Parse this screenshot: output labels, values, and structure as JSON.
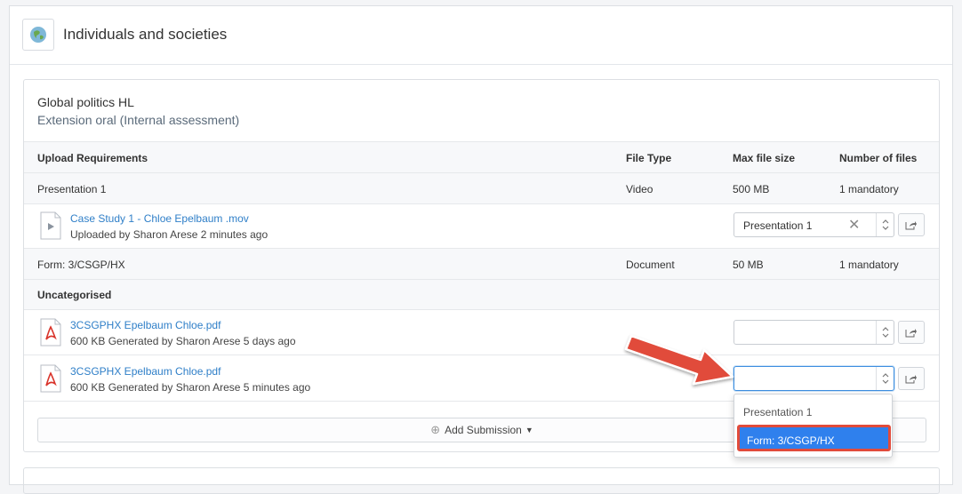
{
  "subject": {
    "title": "Individuals and societies",
    "icon": "globe-icon"
  },
  "course": {
    "title": "Global politics HL",
    "subtitle": "Extension oral (Internal assessment)"
  },
  "table": {
    "headers": [
      "Upload Requirements",
      "File Type",
      "Max file size",
      "Number of files"
    ],
    "requirements": [
      {
        "name": "Presentation 1",
        "type": "Video",
        "size": "500 MB",
        "count": "1 mandatory"
      },
      {
        "name": "Form: 3/CSGP/HX",
        "type": "Document",
        "size": "50 MB",
        "count": "1 mandatory"
      }
    ]
  },
  "files": [
    {
      "name": "Case Study 1 - Chloe Epelbaum .mov",
      "meta": "Uploaded by Sharon Arese 2 minutes ago",
      "icon": "video-file-icon",
      "selected": "Presentation 1"
    },
    {
      "name": "3CSGPHX Epelbaum Chloe.pdf",
      "meta": "600 KB Generated by Sharon Arese 5 days ago",
      "icon": "pdf-file-icon",
      "selected": ""
    },
    {
      "name": "3CSGPHX Epelbaum Chloe.pdf",
      "meta": "600 KB Generated by Sharon Arese 5 minutes ago",
      "icon": "pdf-file-icon",
      "selected": ""
    }
  ],
  "uncategorised_label": "Uncategorised",
  "add_submission_label": "Add Submission",
  "dropdown": {
    "options": [
      "Presentation 1",
      "Form: 3/CSGP/HX"
    ],
    "highlighted": "Form: 3/CSGP/HX"
  },
  "colors": {
    "link": "#2f7fc8",
    "highlight": "#2f80ed",
    "annotation": "#e14b3b"
  }
}
